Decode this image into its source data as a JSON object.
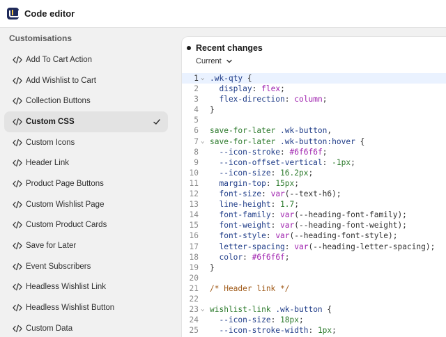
{
  "app": {
    "title": "Code editor"
  },
  "sidebar": {
    "heading": "Customisations",
    "items": [
      {
        "label": "Add To Cart Action",
        "active": false
      },
      {
        "label": "Add Wishlist to Cart",
        "active": false
      },
      {
        "label": "Collection Buttons",
        "active": false
      },
      {
        "label": "Custom CSS",
        "active": true
      },
      {
        "label": "Custom Icons",
        "active": false
      },
      {
        "label": "Header Link",
        "active": false
      },
      {
        "label": "Product Page Buttons",
        "active": false
      },
      {
        "label": "Custom Wishlist Page",
        "active": false
      },
      {
        "label": "Custom Product Cards",
        "active": false
      },
      {
        "label": "Save for Later",
        "active": false
      },
      {
        "label": "Event Subscribers",
        "active": false
      },
      {
        "label": "Headless Wishlist Link",
        "active": false
      },
      {
        "label": "Headless Wishlist Button",
        "active": false
      },
      {
        "label": "Custom Data",
        "active": false
      }
    ]
  },
  "editor": {
    "title": "Recent changes",
    "version_label": "Current",
    "current_line": 1,
    "lines": [
      {
        "n": "1",
        "fold": true,
        "tokens": [
          [
            "sel",
            ".wk-qty"
          ],
          [
            "pun",
            " {"
          ]
        ]
      },
      {
        "n": "2",
        "fold": false,
        "tokens": [
          [
            "prop",
            "  display"
          ],
          [
            "pun",
            ": "
          ],
          [
            "val",
            "flex"
          ],
          [
            "pun",
            ";"
          ]
        ]
      },
      {
        "n": "3",
        "fold": false,
        "tokens": [
          [
            "prop",
            "  flex-direction"
          ],
          [
            "pun",
            ": "
          ],
          [
            "val",
            "column"
          ],
          [
            "pun",
            ";"
          ]
        ]
      },
      {
        "n": "4",
        "fold": false,
        "tokens": [
          [
            "pun",
            "}"
          ]
        ]
      },
      {
        "n": "5",
        "fold": false,
        "tokens": []
      },
      {
        "n": "6",
        "fold": false,
        "tokens": [
          [
            "key",
            "save-for-later"
          ],
          [
            "pun",
            " "
          ],
          [
            "sel",
            ".wk-button"
          ],
          [
            "pun",
            ","
          ]
        ]
      },
      {
        "n": "7",
        "fold": true,
        "tokens": [
          [
            "key",
            "save-for-later"
          ],
          [
            "pun",
            " "
          ],
          [
            "sel",
            ".wk-button:hover"
          ],
          [
            "pun",
            " {"
          ]
        ]
      },
      {
        "n": "8",
        "fold": false,
        "tokens": [
          [
            "prop",
            "  --icon-stroke"
          ],
          [
            "pun",
            ": "
          ],
          [
            "val",
            "#6f6f6f"
          ],
          [
            "pun",
            ";"
          ]
        ]
      },
      {
        "n": "9",
        "fold": false,
        "tokens": [
          [
            "prop",
            "  --icon-offset-vertical"
          ],
          [
            "pun",
            ": "
          ],
          [
            "num",
            "-1px"
          ],
          [
            "pun",
            ";"
          ]
        ]
      },
      {
        "n": "10",
        "fold": false,
        "tokens": [
          [
            "prop",
            "  --icon-size"
          ],
          [
            "pun",
            ": "
          ],
          [
            "num",
            "16.2px"
          ],
          [
            "pun",
            ";"
          ]
        ]
      },
      {
        "n": "11",
        "fold": false,
        "tokens": [
          [
            "prop",
            "  margin-top"
          ],
          [
            "pun",
            ": "
          ],
          [
            "num",
            "15px"
          ],
          [
            "pun",
            ";"
          ]
        ]
      },
      {
        "n": "12",
        "fold": false,
        "tokens": [
          [
            "prop",
            "  font-size"
          ],
          [
            "pun",
            ": "
          ],
          [
            "val",
            "var"
          ],
          [
            "pun",
            "(--text-h6);"
          ]
        ]
      },
      {
        "n": "13",
        "fold": false,
        "tokens": [
          [
            "prop",
            "  line-height"
          ],
          [
            "pun",
            ": "
          ],
          [
            "num",
            "1.7"
          ],
          [
            "pun",
            ";"
          ]
        ]
      },
      {
        "n": "14",
        "fold": false,
        "tokens": [
          [
            "prop",
            "  font-family"
          ],
          [
            "pun",
            ": "
          ],
          [
            "val",
            "var"
          ],
          [
            "pun",
            "(--heading-font-family);"
          ]
        ]
      },
      {
        "n": "15",
        "fold": false,
        "tokens": [
          [
            "prop",
            "  font-weight"
          ],
          [
            "pun",
            ": "
          ],
          [
            "val",
            "var"
          ],
          [
            "pun",
            "(--heading-font-weight);"
          ]
        ]
      },
      {
        "n": "16",
        "fold": false,
        "tokens": [
          [
            "prop",
            "  font-style"
          ],
          [
            "pun",
            ": "
          ],
          [
            "val",
            "var"
          ],
          [
            "pun",
            "(--heading-font-style);"
          ]
        ]
      },
      {
        "n": "17",
        "fold": false,
        "tokens": [
          [
            "prop",
            "  letter-spacing"
          ],
          [
            "pun",
            ": "
          ],
          [
            "val",
            "var"
          ],
          [
            "pun",
            "(--heading-letter-spacing);"
          ]
        ]
      },
      {
        "n": "18",
        "fold": false,
        "tokens": [
          [
            "prop",
            "  color"
          ],
          [
            "pun",
            ": "
          ],
          [
            "val",
            "#6f6f6f"
          ],
          [
            "pun",
            ";"
          ]
        ]
      },
      {
        "n": "19",
        "fold": false,
        "tokens": [
          [
            "pun",
            "}"
          ]
        ]
      },
      {
        "n": "20",
        "fold": false,
        "tokens": []
      },
      {
        "n": "21",
        "fold": false,
        "tokens": [
          [
            "com",
            "/* Header link */"
          ]
        ]
      },
      {
        "n": "22",
        "fold": false,
        "tokens": []
      },
      {
        "n": "23",
        "fold": true,
        "tokens": [
          [
            "key",
            "wishlist-link"
          ],
          [
            "pun",
            " "
          ],
          [
            "sel",
            ".wk-button"
          ],
          [
            "pun",
            " {"
          ]
        ]
      },
      {
        "n": "24",
        "fold": false,
        "tokens": [
          [
            "prop",
            "  --icon-size"
          ],
          [
            "pun",
            ": "
          ],
          [
            "num",
            "18px"
          ],
          [
            "pun",
            ";"
          ]
        ]
      },
      {
        "n": "25",
        "fold": false,
        "tokens": [
          [
            "prop",
            "  --icon-stroke-width"
          ],
          [
            "pun",
            ": "
          ],
          [
            "num",
            "1px"
          ],
          [
            "pun",
            ";"
          ]
        ]
      }
    ]
  },
  "icons": {
    "nav": "code-icon",
    "active_marker": "check-icon",
    "dropdown": "chevron-down-icon"
  },
  "colors": {
    "active_item_bg": "#e3e3e3",
    "current_line_bg": "#eaf2ff",
    "app_icon": "#1f2a5a"
  }
}
